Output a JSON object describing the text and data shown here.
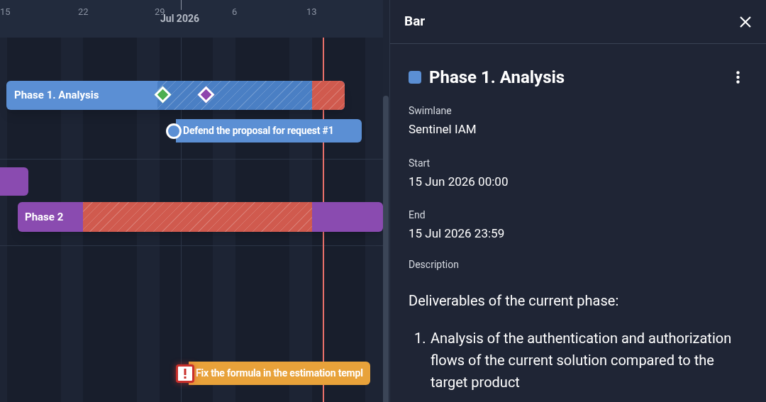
{
  "timeline": {
    "ticks": [
      "15",
      "22",
      "29",
      "6",
      "13"
    ],
    "month": "Jul 2026"
  },
  "bars": [
    {
      "kind": "phase",
      "label": "Phase 1. Analysis",
      "color": "#5b8fd4",
      "overdue": true,
      "milestones": [
        {
          "color": "#4caf50"
        },
        {
          "color": "#8e44ad"
        }
      ]
    },
    {
      "kind": "task",
      "label": "Defend the proposal for request #1",
      "color": "#5b8fd4",
      "warning": false
    },
    {
      "kind": "stub",
      "color": "#8a4bb0"
    },
    {
      "kind": "phase",
      "label": "Phase 2",
      "color": "#8a4bb0",
      "overdue": true
    },
    {
      "kind": "task",
      "label": "Fix the formula in the estimation templ",
      "color": "#e8a23a",
      "warning": true
    }
  ],
  "panel": {
    "header": "Bar",
    "title": "Phase 1. Analysis",
    "color": "#5b8fd4",
    "fields": [
      {
        "label": "Swimlane",
        "value": "Sentinel IAM"
      },
      {
        "label": "Start",
        "value": "15 Jun 2026 00:00"
      },
      {
        "label": "End",
        "value": "15 Jul 2026 23:59"
      }
    ],
    "description_label": "Description",
    "description": {
      "intro": "Deliverables of the current phase:",
      "items": [
        {
          "number": "1.",
          "text": "Analysis of the authentication and authorization flows of the current solution compared to the target product"
        }
      ]
    }
  }
}
